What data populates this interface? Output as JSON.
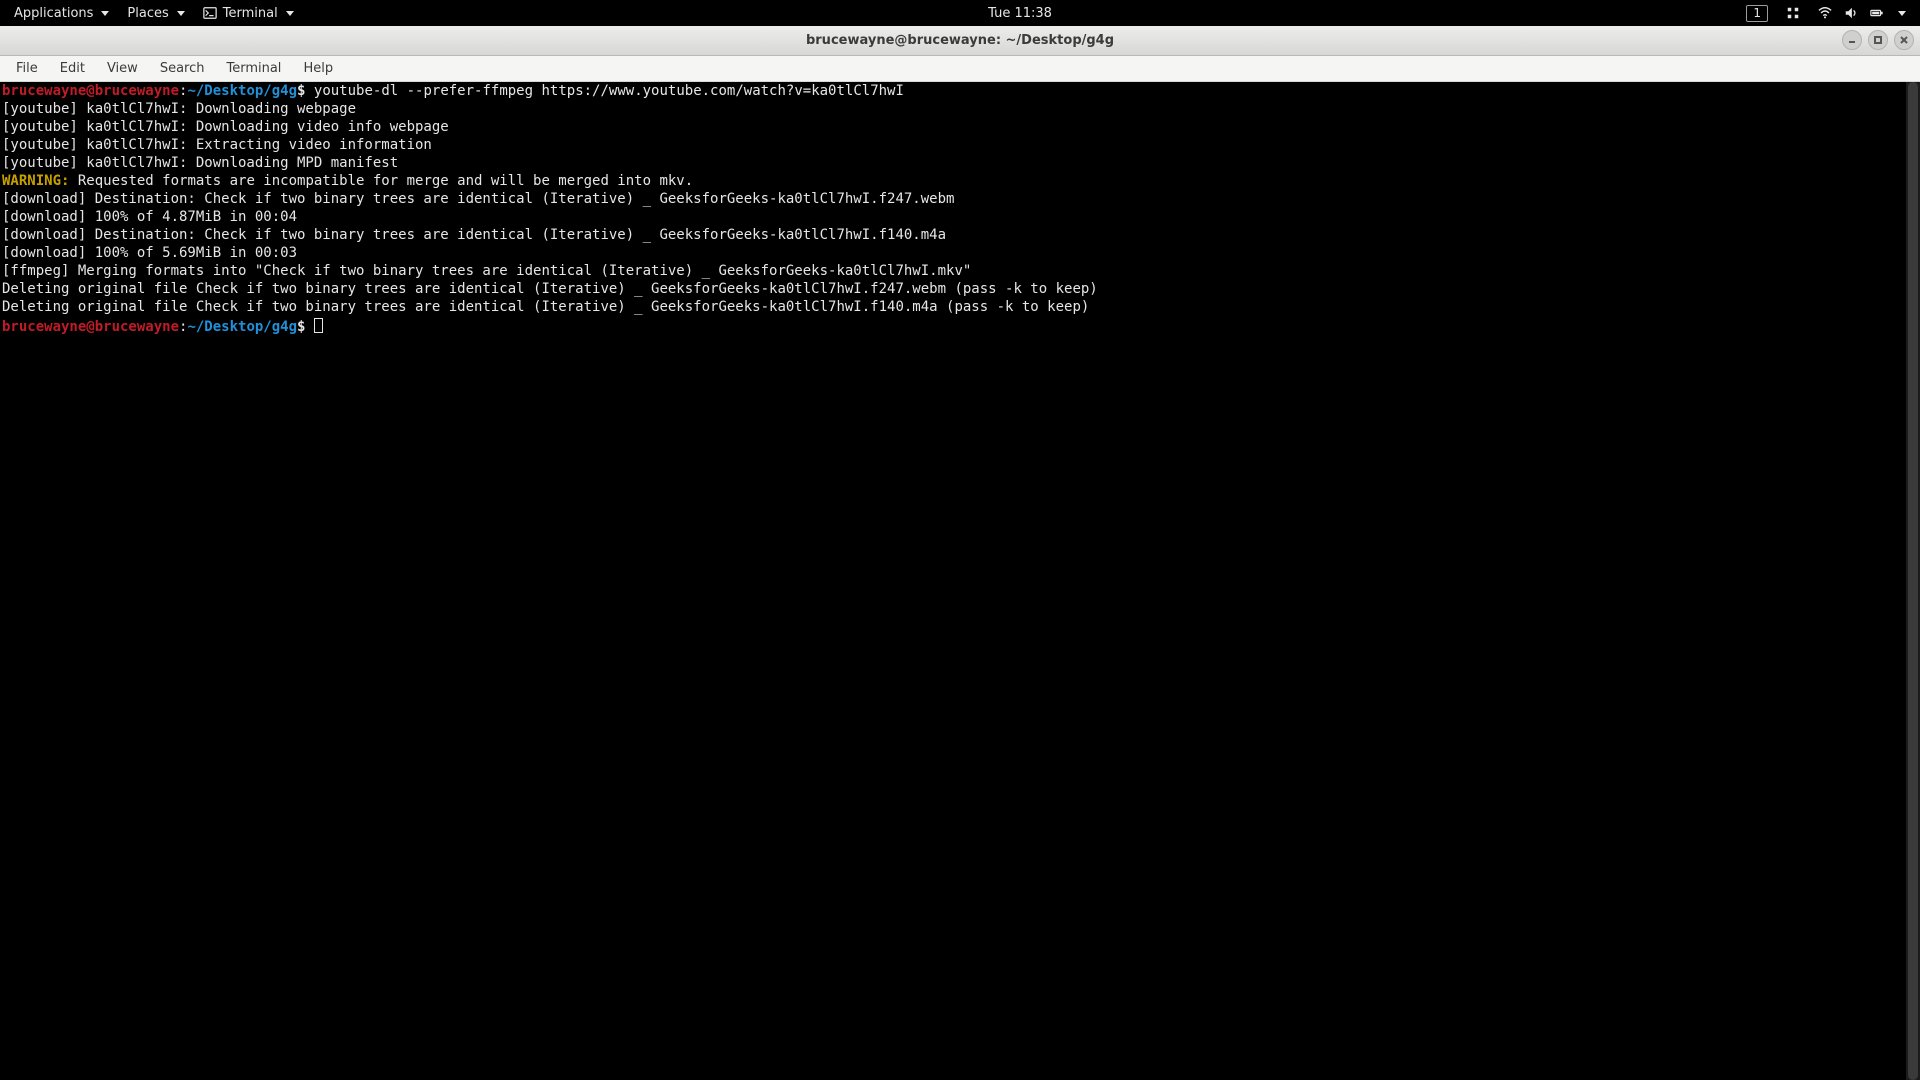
{
  "topbar": {
    "applications": "Applications",
    "places": "Places",
    "app_label": "Terminal",
    "clock": "Tue 11:38",
    "workspace": "1"
  },
  "window": {
    "title": "brucewayne@brucewayne: ~/Desktop/g4g"
  },
  "menubar": {
    "items": [
      "File",
      "Edit",
      "View",
      "Search",
      "Terminal",
      "Help"
    ]
  },
  "prompt": {
    "user_host": "brucewayne@brucewayne",
    "colon": ":",
    "path": "~/Desktop/g4g",
    "dollar": "$"
  },
  "lines": {
    "cmd1": " youtube-dl --prefer-ffmpeg https://www.youtube.com/watch?v=ka0tlCl7hwI",
    "l2": "[youtube] ka0tlCl7hwI: Downloading webpage",
    "l3": "[youtube] ka0tlCl7hwI: Downloading video info webpage",
    "l4": "[youtube] ka0tlCl7hwI: Extracting video information",
    "l5": "[youtube] ka0tlCl7hwI: Downloading MPD manifest",
    "warn_label": "WARNING:",
    "warn_rest": " Requested formats are incompatible for merge and will be merged into mkv.",
    "l7": "[download] Destination: Check if two binary trees are identical (Iterative) _ GeeksforGeeks-ka0tlCl7hwI.f247.webm",
    "l8": "[download] 100% of 4.87MiB in 00:04",
    "l9": "[download] Destination: Check if two binary trees are identical (Iterative) _ GeeksforGeeks-ka0tlCl7hwI.f140.m4a",
    "l10": "[download] 100% of 5.69MiB in 00:03",
    "l11": "[ffmpeg] Merging formats into \"Check if two binary trees are identical (Iterative) _ GeeksforGeeks-ka0tlCl7hwI.mkv\"",
    "l12": "Deleting original file Check if two binary trees are identical (Iterative) _ GeeksforGeeks-ka0tlCl7hwI.f247.webm (pass -k to keep)",
    "l13": "Deleting original file Check if two binary trees are identical (Iterative) _ GeeksforGeeks-ka0tlCl7hwI.f140.m4a (pass -k to keep)",
    "empty": " "
  }
}
